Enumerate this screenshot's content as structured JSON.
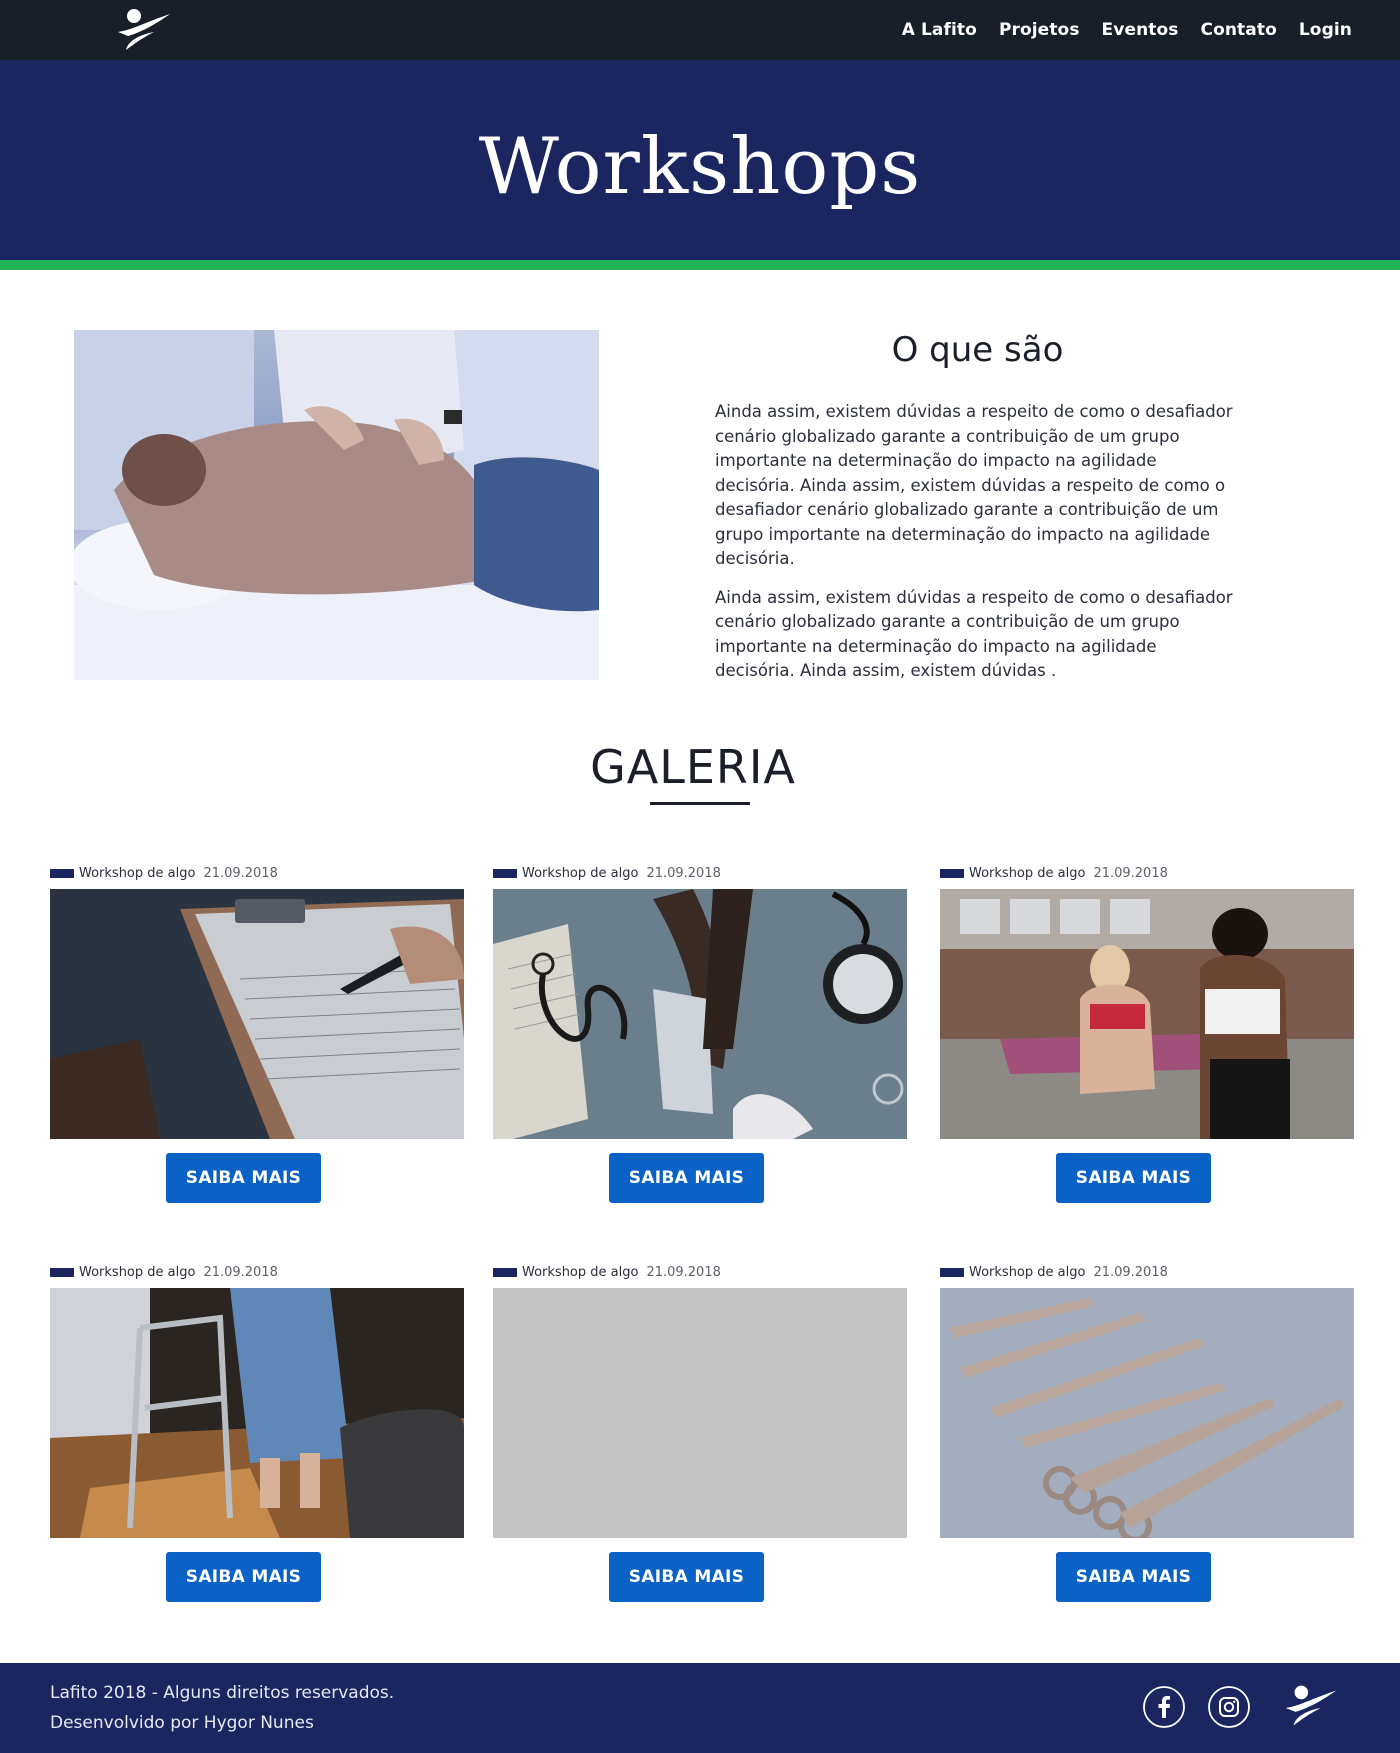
{
  "nav": {
    "logo_icon": "lafito-runner-logo",
    "items": [
      "A Lafito",
      "Projetos",
      "Eventos",
      "Contato",
      "Login"
    ]
  },
  "hero": {
    "title": "Workshops"
  },
  "about": {
    "image_icon": "massage-photo",
    "title": "O que são",
    "paragraphs": [
      "Ainda assim, existem dúvidas a respeito de como o desafiador cenário globalizado garante a contribuição de um grupo importante na determinação do impacto na agilidade decisória. Ainda assim, existem dúvidas a respeito de como o desafiador cenário globalizado garante a contribuição de um grupo importante na determinação do impacto na agilidade decisória.",
      "Ainda assim, existem dúvidas a respeito de como o desafiador cenário globalizado garante a contribuição de um grupo importante na determinação do impacto na agilidade decisória. Ainda assim, existem dúvidas ."
    ]
  },
  "gallery": {
    "title": "GALERIA",
    "cards": [
      {
        "label": "Workshop de algo",
        "date": "21.09.2018",
        "button": "SAIBA MAIS",
        "photo": "clipboard-report-photo"
      },
      {
        "label": "Workshop de algo",
        "date": "21.09.2018",
        "button": "SAIBA MAIS",
        "photo": "blood-pressure-photo"
      },
      {
        "label": "Workshop de algo",
        "date": "21.09.2018",
        "button": "SAIBA MAIS",
        "photo": "fitness-class-photo"
      },
      {
        "label": "Workshop de algo",
        "date": "21.09.2018",
        "button": "SAIBA MAIS",
        "photo": "walker-patient-photo"
      },
      {
        "label": "Workshop de algo",
        "date": "21.09.2018",
        "button": "SAIBA MAIS",
        "photo": "placeholder-photo"
      },
      {
        "label": "Workshop de algo",
        "date": "21.09.2018",
        "button": "SAIBA MAIS",
        "photo": "surgical-tools-photo"
      }
    ]
  },
  "footer": {
    "copyright": "Lafito 2018 - Alguns direitos reservados.",
    "credit": "Desenvolvido por Hygor Nunes",
    "social": [
      "facebook-icon",
      "instagram-icon"
    ]
  },
  "colors": {
    "nav_bg": "#181f29",
    "brand_navy": "#1b2660",
    "accent_green": "#24b25a",
    "button_blue": "#0a62c6"
  }
}
